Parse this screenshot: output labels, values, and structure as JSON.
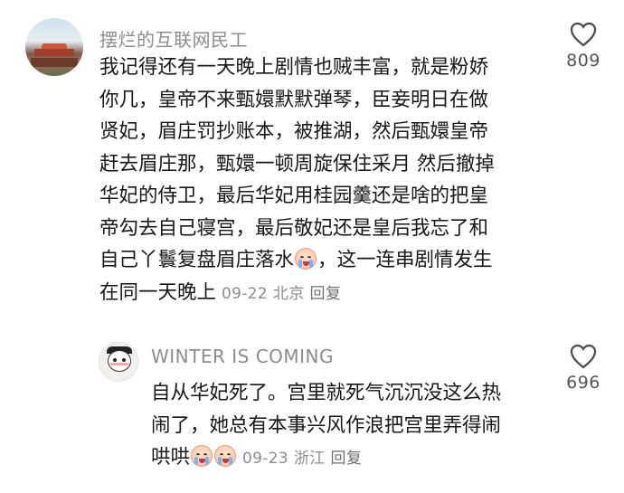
{
  "comment": {
    "username": "摆烂的互联网民工",
    "lines": [
      "我记得还有一天晚上剧情也贼丰富，就是粉娇",
      "你几，皇帝不来甄嬛默默弹琴，臣妾明日在做",
      "贤妃，眉庄罚抄账本，被推湖，然后甄嬛皇帝",
      "赶去眉庄那，甄嬛一顿周旋保住采月 然后撤掉",
      "华妃的侍卫，最后华妃用桂园羹还是啥的把皇",
      "帝勾去自己寝宫，最后敬妃还是皇后我忘了和",
      "自己丫鬟复盘眉庄落水",
      "，这一连串剧情发生",
      "在同一天晚上"
    ],
    "date": "09-22",
    "location": "北京",
    "reply_label": "回复",
    "like_count": "809",
    "emoji": "crying-face-emoji"
  },
  "reply": {
    "username": "WINTER IS COMING",
    "lines": [
      "自从华妃死了。宫里就死气沉沉没这么热",
      "闹了，她总有本事兴风作浪把宫里弄得闹",
      "哄哄"
    ],
    "date": "09-23",
    "location": "浙江",
    "reply_label": "回复",
    "like_count": "696",
    "emoji": "crying-face-emoji"
  }
}
